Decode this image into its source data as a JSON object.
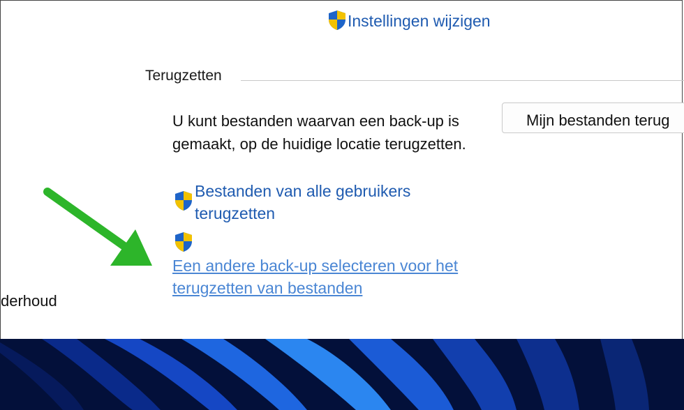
{
  "header": {
    "change_settings_link": "Instellingen wijzigen"
  },
  "restore": {
    "title": "Terugzetten",
    "description": "U kunt bestanden waarvan een back-up is gemaakt, op de huidige locatie terugzetten.",
    "restore_button": "Mijn bestanden terug",
    "all_users_link_line1": "Bestanden van alle gebruikers",
    "all_users_link_line2": "terugzetten",
    "select_backup_link_line1": "Een andere back-up selecteren voor het",
    "select_backup_link_line2": "terugzetten van bestanden"
  },
  "sidebar": {
    "partial_label": "derhoud"
  },
  "icons": {
    "uac": "uac-shield-icon",
    "annotation": "green-arrow-icon"
  },
  "colors": {
    "link": "#1f5bb0",
    "arrow": "#2db52a",
    "wallpaper": "#03103a"
  }
}
